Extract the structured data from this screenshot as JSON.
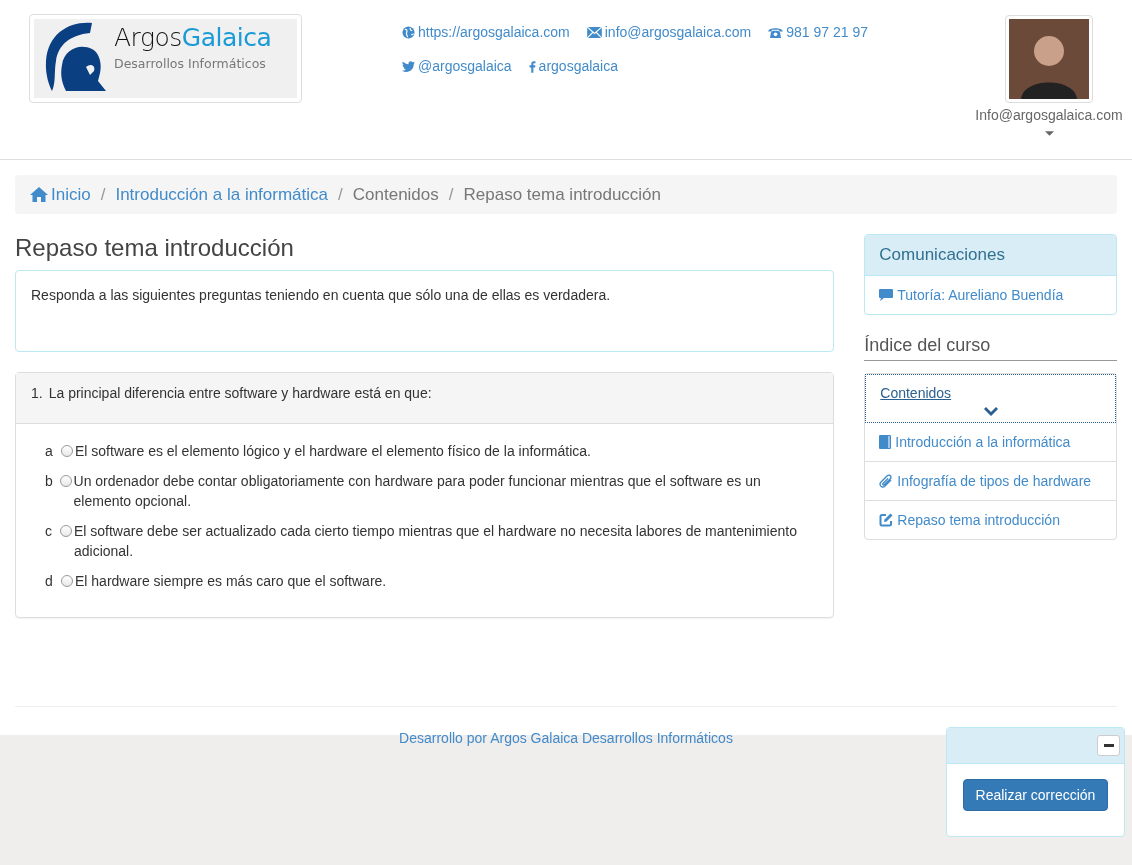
{
  "header": {
    "logo": {
      "name_dark": "Argos",
      "name_accent": "Galaica",
      "subtitle": "Desarrollos Informáticos"
    },
    "contacts": [
      {
        "kind": "web",
        "text": "https://argosgalaica.com"
      },
      {
        "kind": "mail",
        "text": "info@argosgalaica.com"
      },
      {
        "kind": "phone",
        "text": "981 97 21 97"
      },
      {
        "kind": "twitter",
        "text": "@argosgalaica"
      },
      {
        "kind": "facebook",
        "text": "argosgalaica"
      }
    ],
    "user": {
      "name": "Info@argosgalaica.com"
    }
  },
  "breadcrumb_separator": "/",
  "breadcrumb": [
    {
      "text": "Inicio",
      "kind": "home"
    },
    {
      "text": "Introducción a la informática",
      "kind": "link"
    },
    {
      "text": "Contenidos",
      "kind": "plain"
    },
    {
      "text": "Repaso tema introducción",
      "kind": "plain"
    }
  ],
  "page_title": "Repaso tema introducción",
  "instructions": "Responda a las siguientes preguntas teniendo en cuenta que sólo una de ellas es verdadera.",
  "question": {
    "number": "1.",
    "text": "La principal diferencia entre software y hardware está en que:",
    "options": [
      {
        "letter": "a",
        "text": "El software es el elemento lógico y el hardware el elemento físico de la informática.",
        "selected": false
      },
      {
        "letter": "b",
        "text": "Un ordenador debe contar obligatoriamente con hardware para poder funcionar mientras que el software es un elemento opcional.",
        "selected": false
      },
      {
        "letter": "c",
        "text": "El software debe ser actualizado cada cierto tiempo mientras que el hardware no necesita labores de mantenimiento adicional.",
        "selected": false
      },
      {
        "letter": "d",
        "text": "El hardware siempre es más caro que el software.",
        "selected": false
      }
    ]
  },
  "sidebar": {
    "communications": {
      "title": "Comunicaciones",
      "items": [
        "Tutoría: Aureliano Buendía"
      ]
    },
    "index": {
      "title": "Índice del curso",
      "section": "Contenidos",
      "items": [
        {
          "kind": "book",
          "text": "Introducción a la informática"
        },
        {
          "kind": "attachment",
          "text": "Infografía de tipos de hardware"
        },
        {
          "kind": "quiz",
          "text": "Repaso tema introducción"
        }
      ]
    }
  },
  "footer": "Desarrollo por Argos Galaica Desarrollos Informáticos",
  "correction_panel": {
    "button": "Realizar corrección"
  }
}
